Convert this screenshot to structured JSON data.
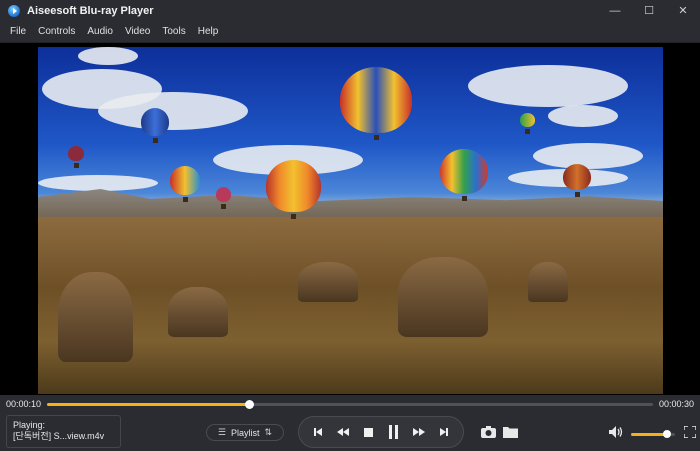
{
  "window": {
    "title": "Aiseesoft Blu-ray Player",
    "minimize_glyph": "—",
    "maximize_glyph": "☐",
    "close_glyph": "✕"
  },
  "menu": {
    "items": [
      "File",
      "Controls",
      "Audio",
      "Video",
      "Tools",
      "Help"
    ]
  },
  "video": {
    "scene": "hot air balloons over rocky valley",
    "icon": "video-frame"
  },
  "progress": {
    "current_time": "00:00:10",
    "total_time": "00:00:30",
    "value": 0.333,
    "color": "#f3b21b"
  },
  "now_playing": {
    "label": "Playing:",
    "file": "[단독버전] S...view.m4v"
  },
  "playlist": {
    "label": "Playlist"
  },
  "volume": {
    "value": 0.82,
    "color": "#f3b21b"
  },
  "icons": {
    "playlist_left": "list-icon",
    "playlist_right": "sort-icon",
    "transport": [
      "skip-previous-icon",
      "rewind-icon",
      "stop-icon",
      "pause-icon",
      "fast-forward-icon",
      "skip-next-icon"
    ],
    "snapshot": "camera-icon",
    "open_folder": "folder-icon",
    "volume": "speaker-icon",
    "fullscreen": "fullscreen-icon"
  }
}
